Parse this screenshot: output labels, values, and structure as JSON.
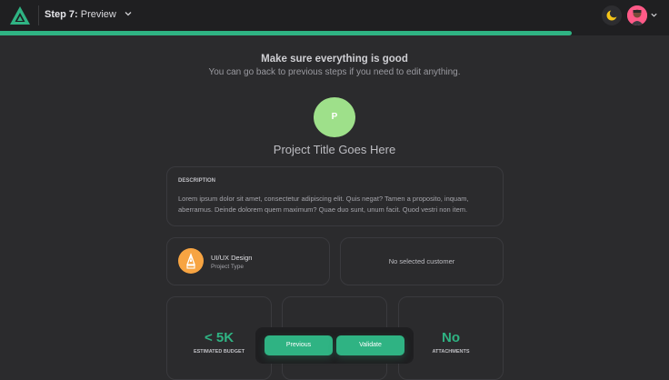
{
  "header": {
    "step_prefix": "Step 7:",
    "step_name": "Preview",
    "progress": 0.855
  },
  "intro": {
    "heading": "Make sure everything is good",
    "subheading": "You can go back to previous steps if you need to edit anything."
  },
  "project": {
    "initial": "P",
    "title": "Project Title Goes Here",
    "tile_color": "#9ee08a"
  },
  "description": {
    "label": "DESCRIPTION",
    "text": "Lorem ipsum dolor sit amet, consectetur adipiscing elit. Quis negat? Tamen a proposito, inquam, aberramus. Deinde dolorem quem maximum? Quae duo sunt, unum facit. Quod vestri non item."
  },
  "project_type": {
    "name": "UI/UX Design",
    "label": "Project Type",
    "icon": "pen-tool-icon",
    "icon_color": "#f7a442"
  },
  "customer": {
    "text": "No selected customer"
  },
  "stats": [
    {
      "value": "< 5K",
      "label": "ESTIMATED BUDGET"
    },
    {
      "value": "",
      "label": ""
    },
    {
      "value": "No",
      "label": "ATTACHMENTS"
    }
  ],
  "actions": {
    "previous": "Previous",
    "validate": "Validate"
  },
  "colors": {
    "accent": "#2fb383",
    "background": "#2b2b2d",
    "topbar": "#1f1f21"
  }
}
